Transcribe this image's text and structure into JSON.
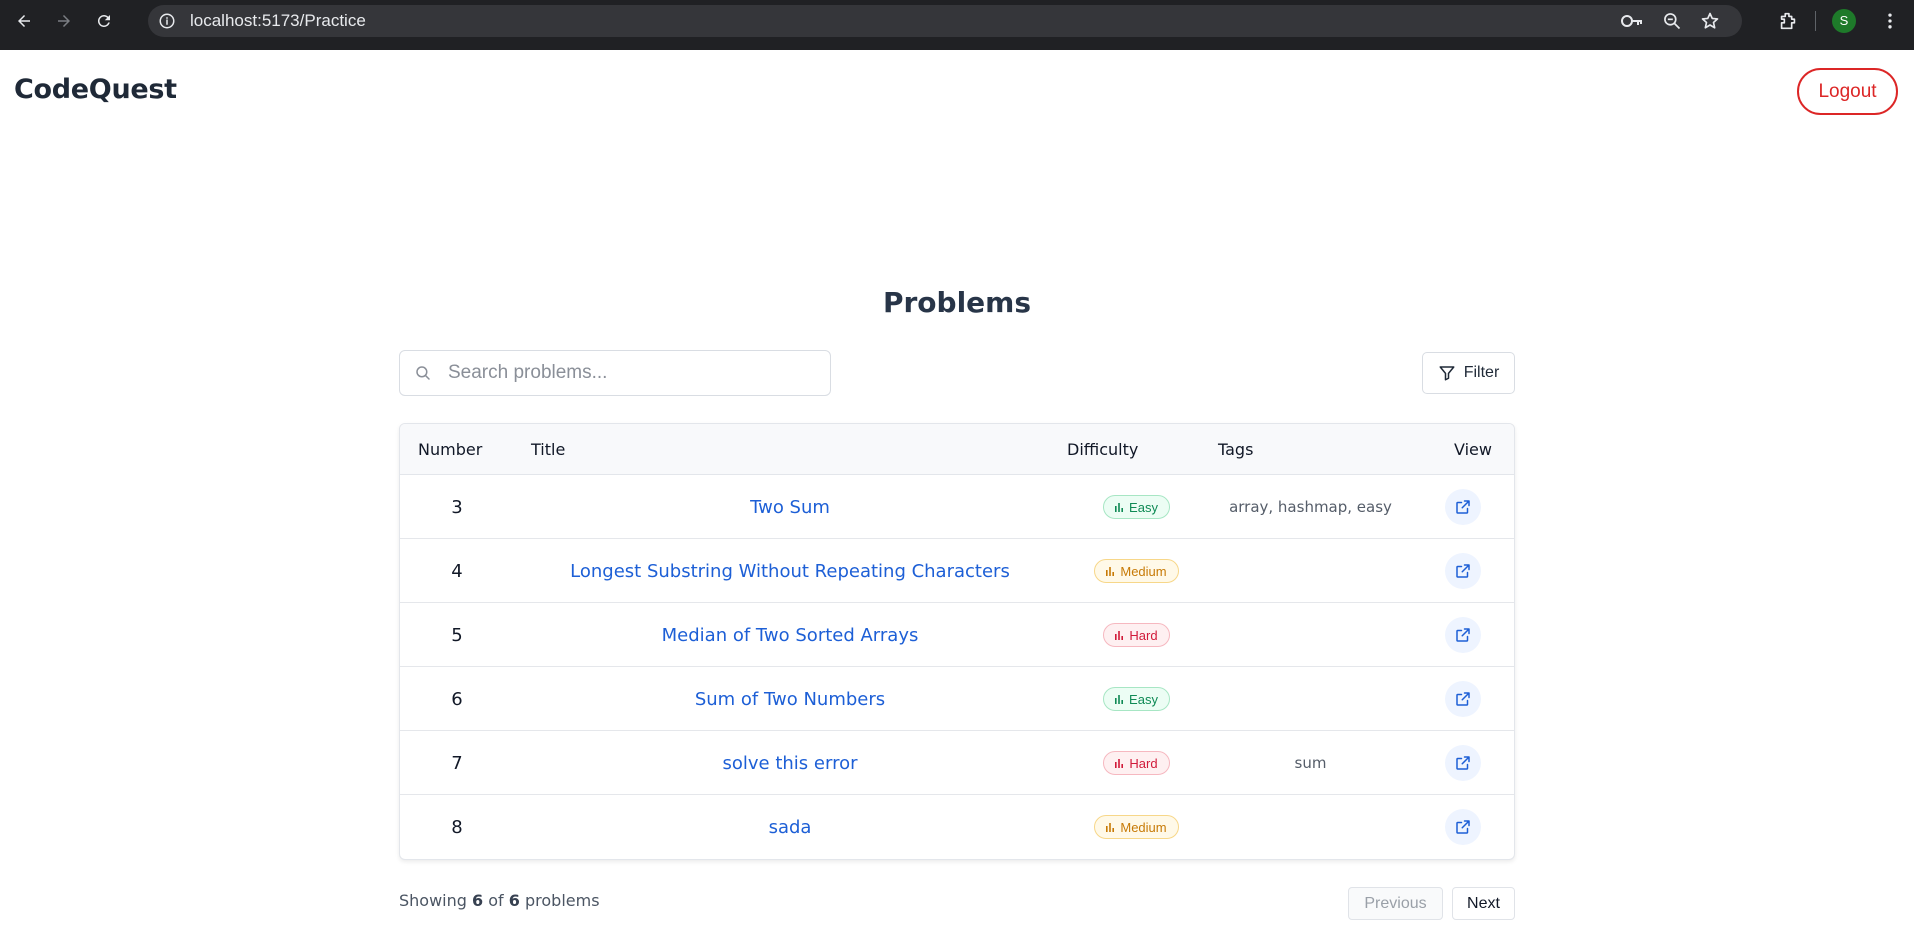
{
  "browser": {
    "url": "localhost:5173/Practice",
    "profile_initial": "S",
    "icons": [
      "back-arrow-icon",
      "forward-arrow-icon",
      "reload-icon",
      "site-info-icon",
      "password-key-icon",
      "zoom-icon",
      "bookmark-star-icon",
      "extensions-icon",
      "more-menu-icon"
    ]
  },
  "header": {
    "brand": "CodeQuest",
    "logout_label": "Logout",
    "accent": "#dc2626"
  },
  "main": {
    "title": "Problems",
    "search_placeholder": "Search problems...",
    "filter_label": "Filter"
  },
  "table": {
    "columns": [
      "Number",
      "Title",
      "Difficulty",
      "Tags",
      "View"
    ],
    "rows": [
      {
        "number": "3",
        "title": "Two Sum",
        "difficulty": "Easy",
        "tags": "array, hashmap, easy"
      },
      {
        "number": "4",
        "title": "Longest Substring Without Repeating Characters",
        "difficulty": "Medium",
        "tags": ""
      },
      {
        "number": "5",
        "title": "Median of Two Sorted Arrays",
        "difficulty": "Hard",
        "tags": ""
      },
      {
        "number": "6",
        "title": "Sum of Two Numbers",
        "difficulty": "Easy",
        "tags": ""
      },
      {
        "number": "7",
        "title": "solve this error",
        "difficulty": "Hard",
        "tags": "sum"
      },
      {
        "number": "8",
        "title": "sada",
        "difficulty": "Medium",
        "tags": ""
      }
    ]
  },
  "footer": {
    "showing_prefix": "Showing",
    "shown": "6",
    "of": "of",
    "total": "6",
    "suffix": "problems",
    "prev_label": "Previous",
    "next_label": "Next"
  }
}
